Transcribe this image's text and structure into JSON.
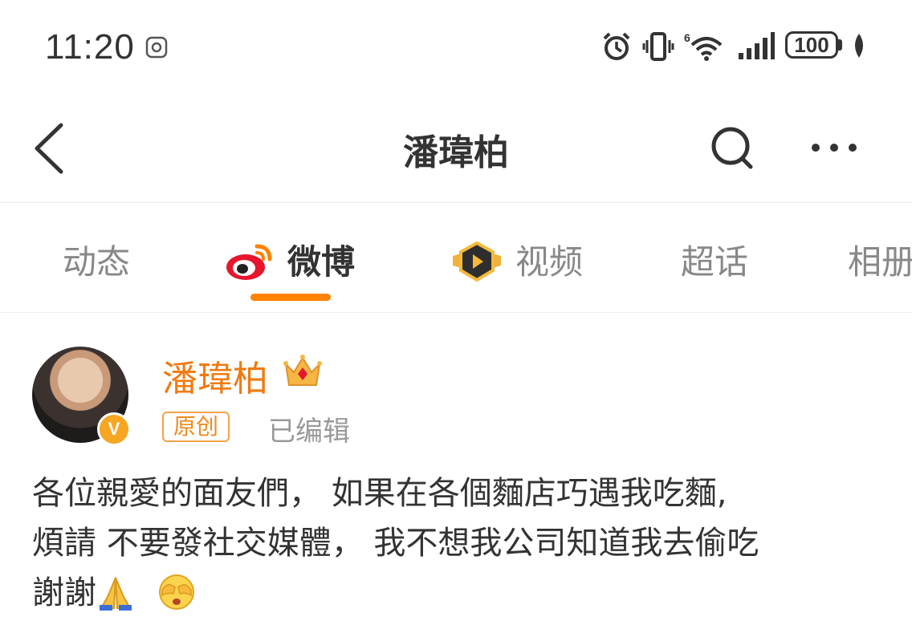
{
  "status_bar": {
    "time": "11:20",
    "battery": "100",
    "icons": [
      "app-notification-icon",
      "alarm-icon",
      "vibrate-icon",
      "wifi-6-icon",
      "signal-icon",
      "battery-icon",
      "eco-icon"
    ]
  },
  "nav": {
    "title": "潘瑋柏",
    "icons": [
      "back-icon",
      "search-icon",
      "more-icon"
    ]
  },
  "tabs": [
    {
      "label": "动态"
    },
    {
      "label": "微博",
      "active": true,
      "icon": "weibo-logo-icon"
    },
    {
      "label": "视频",
      "icon": "video-play-icon"
    },
    {
      "label": "超话"
    },
    {
      "label": "相册"
    }
  ],
  "post": {
    "author": "潘瑋柏",
    "original_tag": "原创",
    "edited_label": "已编辑",
    "text_lines": [
      "各位親愛的面友們， 如果在各個麵店巧遇我吃麵,",
      "煩請 不要發社交媒體， 我不想我公司知道我去偷吃",
      "謝謝"
    ],
    "emojis": [
      "pray-emoji",
      "cover-eyes-emoji"
    ],
    "badges": [
      "verified-v-icon",
      "crown-icon"
    ]
  },
  "colors": {
    "accent": "#ff8200",
    "author_name": "#f07a12",
    "weibo_red": "#e6162d"
  }
}
